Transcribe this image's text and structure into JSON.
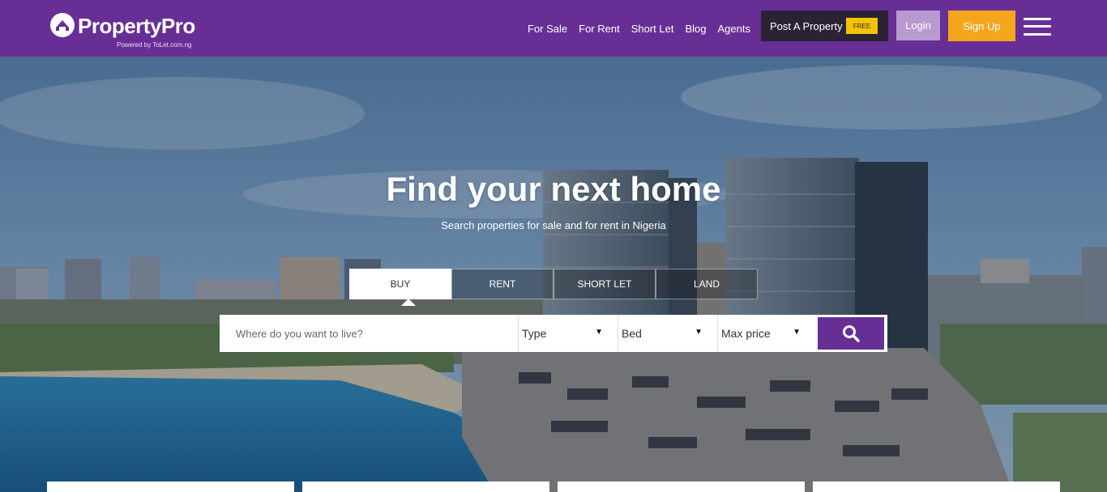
{
  "header": {
    "logo_text": "PropertyPro",
    "logo_sub": "Powered by ToLet.com.ng",
    "nav": [
      "For Sale",
      "For Rent",
      "Short Let",
      "Blog",
      "Agents"
    ],
    "post_property": "Post A Property",
    "free_badge": "FREE",
    "login": "Login",
    "signup": "Sign Up"
  },
  "hero": {
    "title": "Find your next home",
    "subtitle": "Search properties for sale and for rent in Nigeria",
    "tabs": [
      "BUY",
      "RENT",
      "SHORT LET",
      "LAND"
    ],
    "active_tab": "BUY"
  },
  "search": {
    "placeholder": "Where do you want to live?",
    "type_label": "Type",
    "bed_label": "Bed",
    "price_label": "Max price"
  },
  "colors": {
    "brand_purple": "#672f95",
    "accent_orange": "#f4a71d",
    "free_yellow": "#f5c400",
    "login_lilac": "#b89ad0"
  }
}
